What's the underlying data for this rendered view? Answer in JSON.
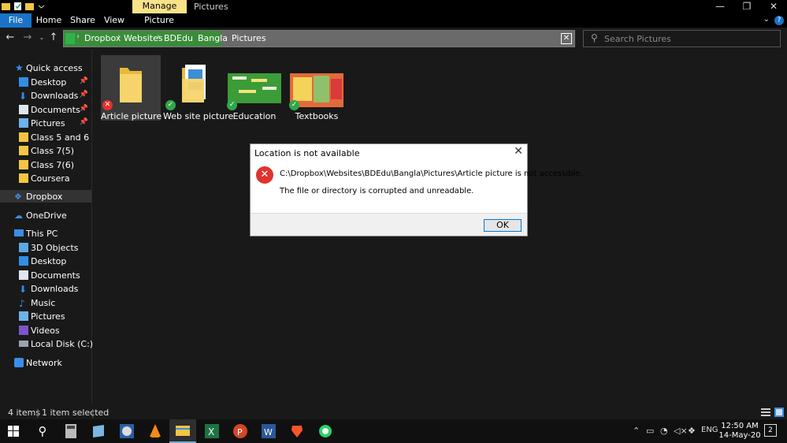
{
  "window": {
    "title": "Pictures",
    "contextual_tab": "Manage",
    "controls": [
      "minimize-icon",
      "restore-icon",
      "close-icon"
    ]
  },
  "ribbon": {
    "tabs": [
      "File",
      "Home",
      "Share",
      "View",
      "Picture Tools"
    ],
    "accent": "#1a73c6"
  },
  "address": {
    "crumbs": [
      "Dropbox",
      "Websites",
      "BDEdu",
      "Bangla",
      "Pictures"
    ],
    "highlight_color": "#3a8c3a"
  },
  "search": {
    "placeholder": "Search Pictures"
  },
  "sidebar": {
    "items": [
      {
        "label": "Quick access",
        "icon": "star-icon"
      },
      {
        "label": "Desktop",
        "icon": "desktop-icon",
        "pinned": true
      },
      {
        "label": "Downloads",
        "icon": "download-icon",
        "pinned": true
      },
      {
        "label": "Documents",
        "icon": "documents-icon",
        "pinned": true
      },
      {
        "label": "Pictures",
        "icon": "pictures-icon",
        "pinned": true
      },
      {
        "label": "Class 5 and 6",
        "icon": "folder-icon"
      },
      {
        "label": "Class 7(5)",
        "icon": "folder-icon"
      },
      {
        "label": "Class 7(6)",
        "icon": "folder-icon"
      },
      {
        "label": "Coursera",
        "icon": "folder-icon"
      },
      {
        "label": "Dropbox",
        "icon": "dropbox-icon",
        "selected": true
      },
      {
        "label": "OneDrive",
        "icon": "onedrive-icon"
      },
      {
        "label": "This PC",
        "icon": "pc-icon"
      },
      {
        "label": "3D Objects",
        "icon": "cube-icon"
      },
      {
        "label": "Desktop",
        "icon": "desktop-icon"
      },
      {
        "label": "Documents",
        "icon": "documents-icon"
      },
      {
        "label": "Downloads",
        "icon": "download-icon"
      },
      {
        "label": "Music",
        "icon": "music-icon"
      },
      {
        "label": "Pictures",
        "icon": "pictures-icon"
      },
      {
        "label": "Videos",
        "icon": "videos-icon"
      },
      {
        "label": "Local Disk (C:)",
        "icon": "disk-icon"
      },
      {
        "label": "Network",
        "icon": "network-icon"
      }
    ]
  },
  "files": [
    {
      "label": "Article picture",
      "status": "error",
      "selected": true
    },
    {
      "label": "Web site picture",
      "status": "synced"
    },
    {
      "label": "Education",
      "status": "synced"
    },
    {
      "label": "Textbooks",
      "status": "synced"
    }
  ],
  "status_bar": {
    "count": "4 items",
    "selected": "1 item selected"
  },
  "dialog": {
    "title": "Location is not available",
    "message": "C:\\Dropbox\\Websites\\BDEdu\\Bangla\\Pictures\\Article picture is not accessible.",
    "detail": "The file or directory is corrupted and unreadable.",
    "ok_label": "OK",
    "close_glyph": "✕"
  },
  "taskbar": {
    "apps": [
      "windows-icon",
      "search-icon",
      "calculator-icon",
      "notepad-icon",
      "photo-viewer-icon",
      "vlc-icon",
      "file-explorer-icon",
      "excel-icon",
      "powerpoint-icon",
      "word-icon",
      "brave-icon",
      "whatsapp-icon"
    ],
    "language": "ENG",
    "time": "12:50 AM",
    "date": "14-May-20",
    "notification_count": "2"
  }
}
